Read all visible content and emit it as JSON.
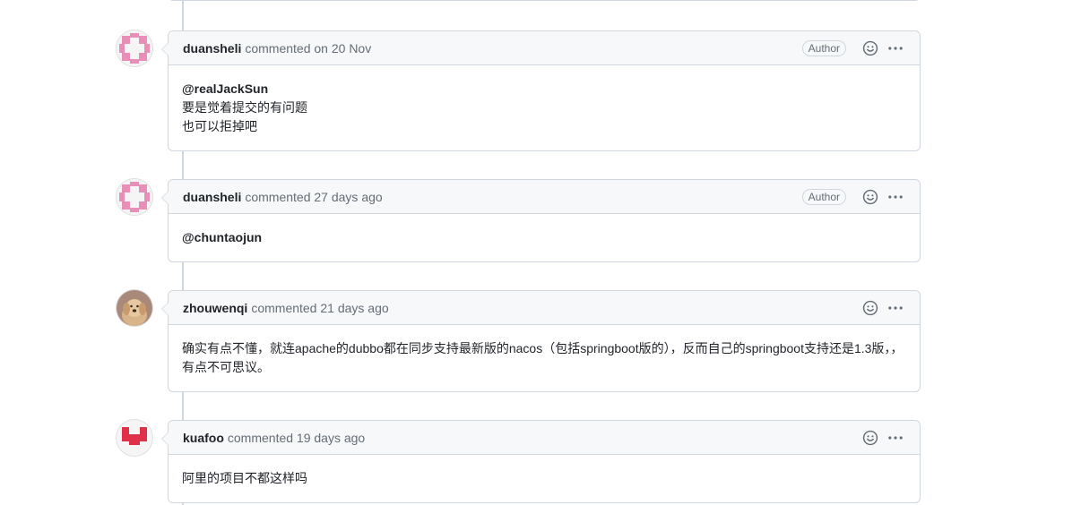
{
  "comments": [
    {
      "author": "duansheli",
      "meta": "commented on 20 Nov",
      "badge": "Author",
      "avatar": "identicon-pink",
      "mention": "@realJackSun",
      "lines": [
        "要是觉着提交的有问题",
        "也可以拒掉吧"
      ]
    },
    {
      "author": "duansheli",
      "meta": "commented 27 days ago",
      "badge": "Author",
      "avatar": "identicon-pink",
      "mention": "@chuntaojun",
      "lines": []
    },
    {
      "author": "zhouwenqi",
      "meta": "commented 21 days ago",
      "badge": "",
      "avatar": "dog-photo",
      "mention": "",
      "lines": [
        "确实有点不懂，就连apache的dubbo都在同步支持最新版的nacos（包括springboot版的），反而自己的springboot支持还是1.3版，，有点不可思议。"
      ]
    },
    {
      "author": "kuafoo",
      "meta": "commented 19 days ago",
      "badge": "",
      "avatar": "identicon-red",
      "mention": "",
      "lines": [
        "阿里的项目不都这样吗"
      ]
    }
  ],
  "icons": {
    "reaction": "smiley-icon",
    "menu": "kebab-horizontal-icon"
  },
  "colors": {
    "border": "#d0d7de",
    "header_bg": "#f6f8fa",
    "muted_text": "#656d76",
    "identicon_pink": "#e88fb8",
    "identicon_red": "#e0314b"
  }
}
